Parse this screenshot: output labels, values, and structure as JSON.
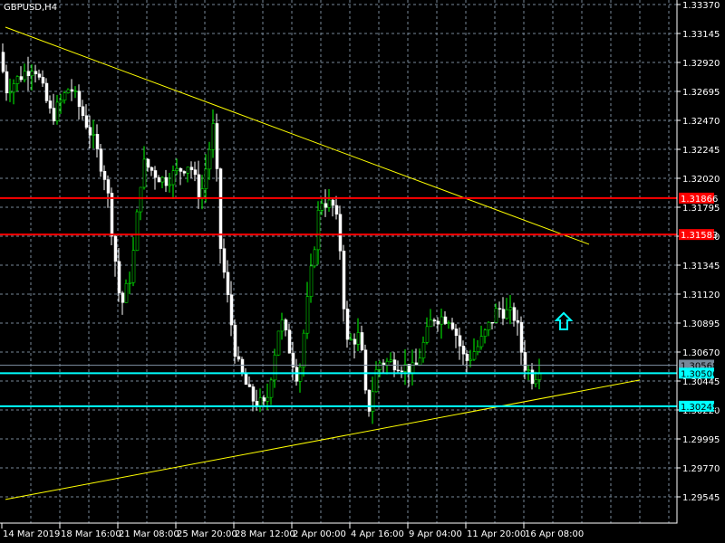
{
  "title": "GBPUSD,H4",
  "colors": {
    "bg": "#000000",
    "grid": "#778899",
    "bull": "#00ff00",
    "bear": "#ffffff",
    "support": "#00ffff",
    "resistance": "#ff0000",
    "trend": "#ffff00",
    "bid": "#778899"
  },
  "chart_data": {
    "type": "candlestick",
    "symbol": "GBPUSD",
    "timeframe": "H4",
    "ylim": [
      1.29434,
      1.33434
    ],
    "y_ticks": [
      "1.33370",
      "1.33145",
      "1.32920",
      "1.32695",
      "1.32470",
      "1.32245",
      "1.32020",
      "1.31795",
      "1.31570",
      "1.31345",
      "1.31120",
      "1.30895",
      "1.30670",
      "1.30445",
      "1.30220",
      "1.29995",
      "1.29770",
      "1.29545"
    ],
    "x_ticks": [
      {
        "index": 0,
        "label": "14 Mar 2019"
      },
      {
        "index": 16,
        "label": "18 Mar 16:00"
      },
      {
        "index": 32,
        "label": "21 Mar 08:00"
      },
      {
        "index": 48,
        "label": "25 Mar 20:00"
      },
      {
        "index": 64,
        "label": "28 Mar 12:00"
      },
      {
        "index": 80,
        "label": "2 Apr 00:00"
      },
      {
        "index": 96,
        "label": "4 Apr 16:00"
      },
      {
        "index": 112,
        "label": "9 Apr 04:00"
      },
      {
        "index": 128,
        "label": "11 Apr 20:00"
      },
      {
        "index": 144,
        "label": "16 Apr 08:00"
      }
    ],
    "price_path_waypoints": [
      [
        0,
        1.33
      ],
      [
        1,
        1.327
      ],
      [
        9,
        1.3291
      ],
      [
        14,
        1.3249
      ],
      [
        19,
        1.3274
      ],
      [
        25,
        1.3235
      ],
      [
        29,
        1.32
      ],
      [
        33,
        1.3101
      ],
      [
        36,
        1.313
      ],
      [
        39,
        1.3214
      ],
      [
        45,
        1.32
      ],
      [
        52,
        1.3214
      ],
      [
        55,
        1.3186
      ],
      [
        59,
        1.3249
      ],
      [
        60,
        1.3158
      ],
      [
        65,
        1.3059
      ],
      [
        69,
        1.3031
      ],
      [
        73,
        1.3024
      ],
      [
        77,
        1.3094
      ],
      [
        82,
        1.3045
      ],
      [
        84,
        1.3094
      ],
      [
        88,
        1.3186
      ],
      [
        92,
        1.3179
      ],
      [
        94,
        1.3137
      ],
      [
        95,
        1.3073
      ],
      [
        99,
        1.308
      ],
      [
        101,
        1.3017
      ],
      [
        104,
        1.3059
      ],
      [
        109,
        1.3059
      ],
      [
        114,
        1.3052
      ],
      [
        119,
        1.3094
      ],
      [
        124,
        1.3094
      ],
      [
        128,
        1.3059
      ],
      [
        132,
        1.3073
      ],
      [
        137,
        1.3101
      ],
      [
        142,
        1.3094
      ],
      [
        144,
        1.3059
      ],
      [
        147,
        1.3045
      ],
      [
        148,
        1.3056
      ]
    ],
    "horizontal_levels": [
      {
        "price": "1.31866",
        "kind": "resistance"
      },
      {
        "price": "1.31583",
        "kind": "resistance"
      },
      {
        "price": "1.30568",
        "kind": "bid"
      },
      {
        "price": "1.30506",
        "kind": "support"
      },
      {
        "price": "1.30249",
        "kind": "support"
      }
    ],
    "trendlines": [
      {
        "from": [
          1,
          1.33194
        ],
        "to": [
          162,
          1.31507
        ]
      },
      {
        "from": [
          1,
          1.29525
        ],
        "to": [
          176,
          1.30453
        ]
      }
    ],
    "arrow": {
      "index": 155,
      "price": 1.3091,
      "direction": "up"
    }
  }
}
